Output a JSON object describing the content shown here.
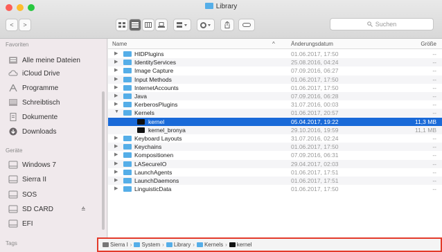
{
  "window": {
    "title": "Library"
  },
  "toolbar": {
    "back": "<",
    "forward": ">",
    "search_placeholder": "Suchen"
  },
  "sidebar": {
    "favorites_header": "Favoriten",
    "devices_header": "Geräte",
    "tags_header": "Tags",
    "favorites": [
      {
        "label": "Alle meine Dateien",
        "icon": "all-files-icon"
      },
      {
        "label": "iCloud Drive",
        "icon": "cloud-icon"
      },
      {
        "label": "Programme",
        "icon": "applications-icon"
      },
      {
        "label": "Schreibtisch",
        "icon": "desktop-icon"
      },
      {
        "label": "Dokumente",
        "icon": "documents-icon"
      },
      {
        "label": "Downloads",
        "icon": "downloads-icon"
      }
    ],
    "devices": [
      {
        "label": "Windows 7",
        "icon": "disk-icon"
      },
      {
        "label": "Sierra II",
        "icon": "disk-icon"
      },
      {
        "label": "SOS",
        "icon": "disk-icon"
      },
      {
        "label": "SD CARD",
        "icon": "disk-icon",
        "eject": "≙"
      },
      {
        "label": "EFI",
        "icon": "disk-icon"
      }
    ]
  },
  "columns": {
    "name": "Name",
    "date": "Änderungsdatum",
    "size": "Größe"
  },
  "rows": [
    {
      "name": "HIDPlugins",
      "date": "01.06.2017, 17:50",
      "size": "--",
      "type": "folder",
      "expanded": false
    },
    {
      "name": "IdentityServices",
      "date": "25.08.2016, 04:24",
      "size": "--",
      "type": "folder",
      "expanded": false
    },
    {
      "name": "Image Capture",
      "date": "07.09.2016, 06:27",
      "size": "--",
      "type": "folder",
      "expanded": false
    },
    {
      "name": "Input Methods",
      "date": "01.06.2017, 17:50",
      "size": "--",
      "type": "folder",
      "expanded": false
    },
    {
      "name": "InternetAccounts",
      "date": "01.06.2017, 17:50",
      "size": "--",
      "type": "folder",
      "expanded": false
    },
    {
      "name": "Java",
      "date": "07.09.2016, 06:28",
      "size": "--",
      "type": "folder",
      "expanded": false
    },
    {
      "name": "KerberosPlugins",
      "date": "31.07.2016, 00:03",
      "size": "--",
      "type": "folder",
      "expanded": false
    },
    {
      "name": "Kernels",
      "date": "01.06.2017, 20:57",
      "size": "--",
      "type": "folder",
      "expanded": true
    },
    {
      "name": "kernel",
      "date": "05.04.2017, 19:22",
      "size": "11,3 MB",
      "type": "kernel",
      "selected": true,
      "child": true
    },
    {
      "name": "kernel_bronya",
      "date": "29.10.2016, 19:59",
      "size": "11,1 MB",
      "type": "kernel",
      "child": true
    },
    {
      "name": "Keyboard Layouts",
      "date": "31.07.2016, 02:24",
      "size": "--",
      "type": "folder",
      "expanded": false
    },
    {
      "name": "Keychains",
      "date": "01.06.2017, 17:50",
      "size": "--",
      "type": "folder",
      "expanded": false
    },
    {
      "name": "Kompositionen",
      "date": "07.09.2016, 06:31",
      "size": "--",
      "type": "folder",
      "expanded": false
    },
    {
      "name": "LASecureIO",
      "date": "29.04.2017, 02:03",
      "size": "--",
      "type": "folder",
      "expanded": false
    },
    {
      "name": "LaunchAgents",
      "date": "01.06.2017, 17:51",
      "size": "--",
      "type": "folder",
      "expanded": false
    },
    {
      "name": "LaunchDaemons",
      "date": "01.06.2017, 17:51",
      "size": "--",
      "type": "folder",
      "expanded": false
    },
    {
      "name": "LinguisticData",
      "date": "01.06.2017, 17:50",
      "size": "--",
      "type": "folder",
      "expanded": false
    }
  ],
  "pathbar": [
    {
      "label": "Sierra I",
      "type": "disk"
    },
    {
      "label": "System",
      "type": "folder"
    },
    {
      "label": "Library",
      "type": "folder"
    },
    {
      "label": "Kernels",
      "type": "folder"
    },
    {
      "label": "kernel",
      "type": "kernel"
    }
  ],
  "colors": {
    "selection": "#1a6ad8",
    "folder": "#55aee8",
    "highlight_border": "#e33a2a"
  }
}
